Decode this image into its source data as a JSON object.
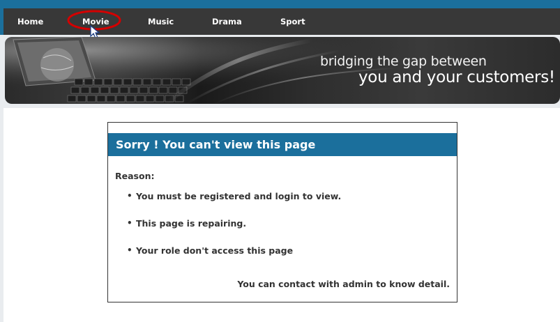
{
  "nav": {
    "items": [
      "Home",
      "Movie",
      "Music",
      "Drama",
      "Sport"
    ],
    "highlighted": "Movie",
    "highlight_color": "#d40000"
  },
  "banner": {
    "tagline_line1": "bridging the gap between",
    "tagline_line2": "you and your customers!"
  },
  "error": {
    "title": "Sorry ! You can't view this page",
    "reason_label": "Reason:",
    "reasons": [
      "You must be registered and login to view.",
      "This page is repairing.",
      "Your role don't access this page"
    ],
    "contact": "You can contact with admin to know detail."
  },
  "colors": {
    "accent_blue": "#1b6f9c",
    "nav_dark": "#383838",
    "text_dark": "#333333"
  }
}
